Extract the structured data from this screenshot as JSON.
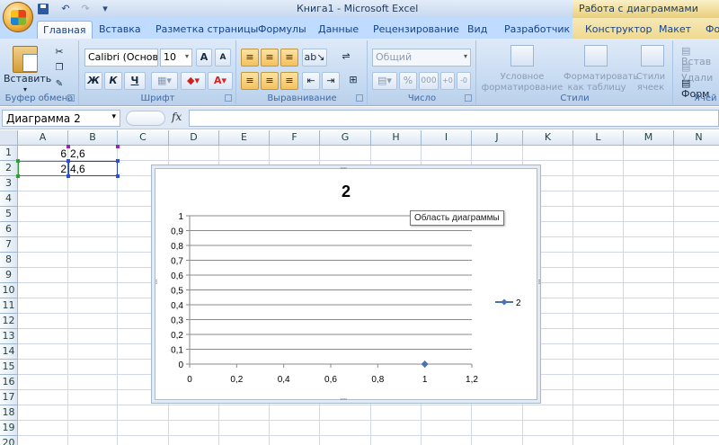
{
  "window": {
    "title": "Книга1 - Microsoft Excel",
    "context_title": "Работа с диаграммами"
  },
  "tabs": [
    {
      "label": "Главная",
      "active": true
    },
    {
      "label": "Вставка"
    },
    {
      "label": "Разметка страницы"
    },
    {
      "label": "Формулы"
    },
    {
      "label": "Данные"
    },
    {
      "label": "Рецензирование"
    },
    {
      "label": "Вид"
    },
    {
      "label": "Разработчик"
    },
    {
      "label": "Конструктор"
    },
    {
      "label": "Макет"
    },
    {
      "label": "Фо"
    }
  ],
  "ribbon": {
    "clipboard": {
      "label": "Буфер обмена",
      "paste": "Вставить"
    },
    "font": {
      "label": "Шрифт",
      "name": "Calibri (Основн",
      "size": "10",
      "bold": "Ж",
      "italic": "К",
      "underline": "Ч"
    },
    "alignment": {
      "label": "Выравнивание"
    },
    "number": {
      "label": "Число",
      "format": "Общий",
      "percent": "%",
      "thousands": "000"
    },
    "styles": {
      "label": "Стили",
      "conditional": "Условное форматирование",
      "as_table": "Форматировать как таблицу",
      "cell_styles": "Стили ячеек"
    },
    "cells": {
      "label": "Ячей",
      "insert": "Встав",
      "delete": "Удали",
      "format": "Форм"
    }
  },
  "formula_bar": {
    "name_box": "Диаграмма 2",
    "fx": "fx",
    "formula": ""
  },
  "sheet": {
    "columns": [
      "A",
      "B",
      "C",
      "D",
      "E",
      "F",
      "G",
      "H",
      "I",
      "J",
      "K",
      "L",
      "M",
      "N"
    ],
    "rows": [
      "1",
      "2",
      "3",
      "4",
      "5",
      "6",
      "7",
      "8",
      "9",
      "10",
      "11",
      "12",
      "13",
      "14",
      "15",
      "16",
      "17",
      "18",
      "19",
      "20"
    ],
    "cells": {
      "A1": "6",
      "B1": "2,6",
      "A2": "2",
      "B2": "4,6"
    }
  },
  "chart_tooltip": "Область диаграммы",
  "chart_data": {
    "type": "scatter",
    "title": "2",
    "x_ticks": [
      "0",
      "0,2",
      "0,4",
      "0,6",
      "0,8",
      "1",
      "1,2"
    ],
    "y_ticks": [
      "0",
      "0,1",
      "0,2",
      "0,3",
      "0,4",
      "0,5",
      "0,6",
      "0,7",
      "0,8",
      "0,9",
      "1"
    ],
    "xlim": [
      0,
      1.2
    ],
    "ylim": [
      0,
      1
    ],
    "series": [
      {
        "name": "2",
        "x": [
          1
        ],
        "y": [
          0
        ],
        "color": "#4a72b0"
      }
    ],
    "legend": "right",
    "grid": true
  }
}
